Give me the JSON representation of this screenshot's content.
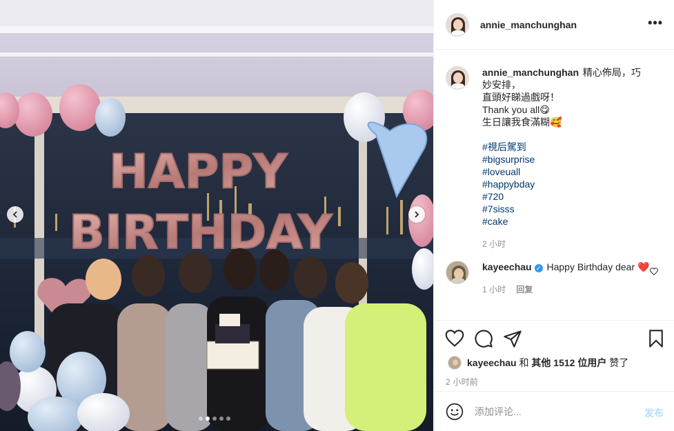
{
  "post": {
    "username": "annie_manchunghan",
    "more_icon": "more-horizontal-icon"
  },
  "photo": {
    "balloon_text_line1": "HAPPY",
    "balloon_text_line2": "BIRTHDAY",
    "slides_total": 5,
    "slide_active": 2
  },
  "caption": {
    "username": "annie_manchunghan",
    "lines": [
      "精心佈局，巧妙安排，",
      "直頭好睇過戲呀！",
      "Thank you all😋",
      "生日讓我食滿糊🥰"
    ],
    "hashtags": [
      "#視后駕到",
      "#bigsurprise",
      "#loveuall",
      "#happybday",
      "#720",
      "#7sisss",
      "#cake"
    ],
    "time": "2 小时"
  },
  "comment": {
    "username": "kayeechau",
    "text": "Happy Birthday dear",
    "emoji": "❤️",
    "time": "1 小时",
    "reply_label": "回复"
  },
  "likes": {
    "user": "kayeechau",
    "connector": "和",
    "others": "其他 1512 位用户",
    "suffix": "赞了"
  },
  "post_time": "2 小时前",
  "add_comment": {
    "placeholder": "添加评论...",
    "post_label": "发布"
  },
  "colors": {
    "link": "#00376b",
    "post_disabled": "#b2dffc",
    "verified": "#3897f0",
    "heart": "#ed4956"
  }
}
